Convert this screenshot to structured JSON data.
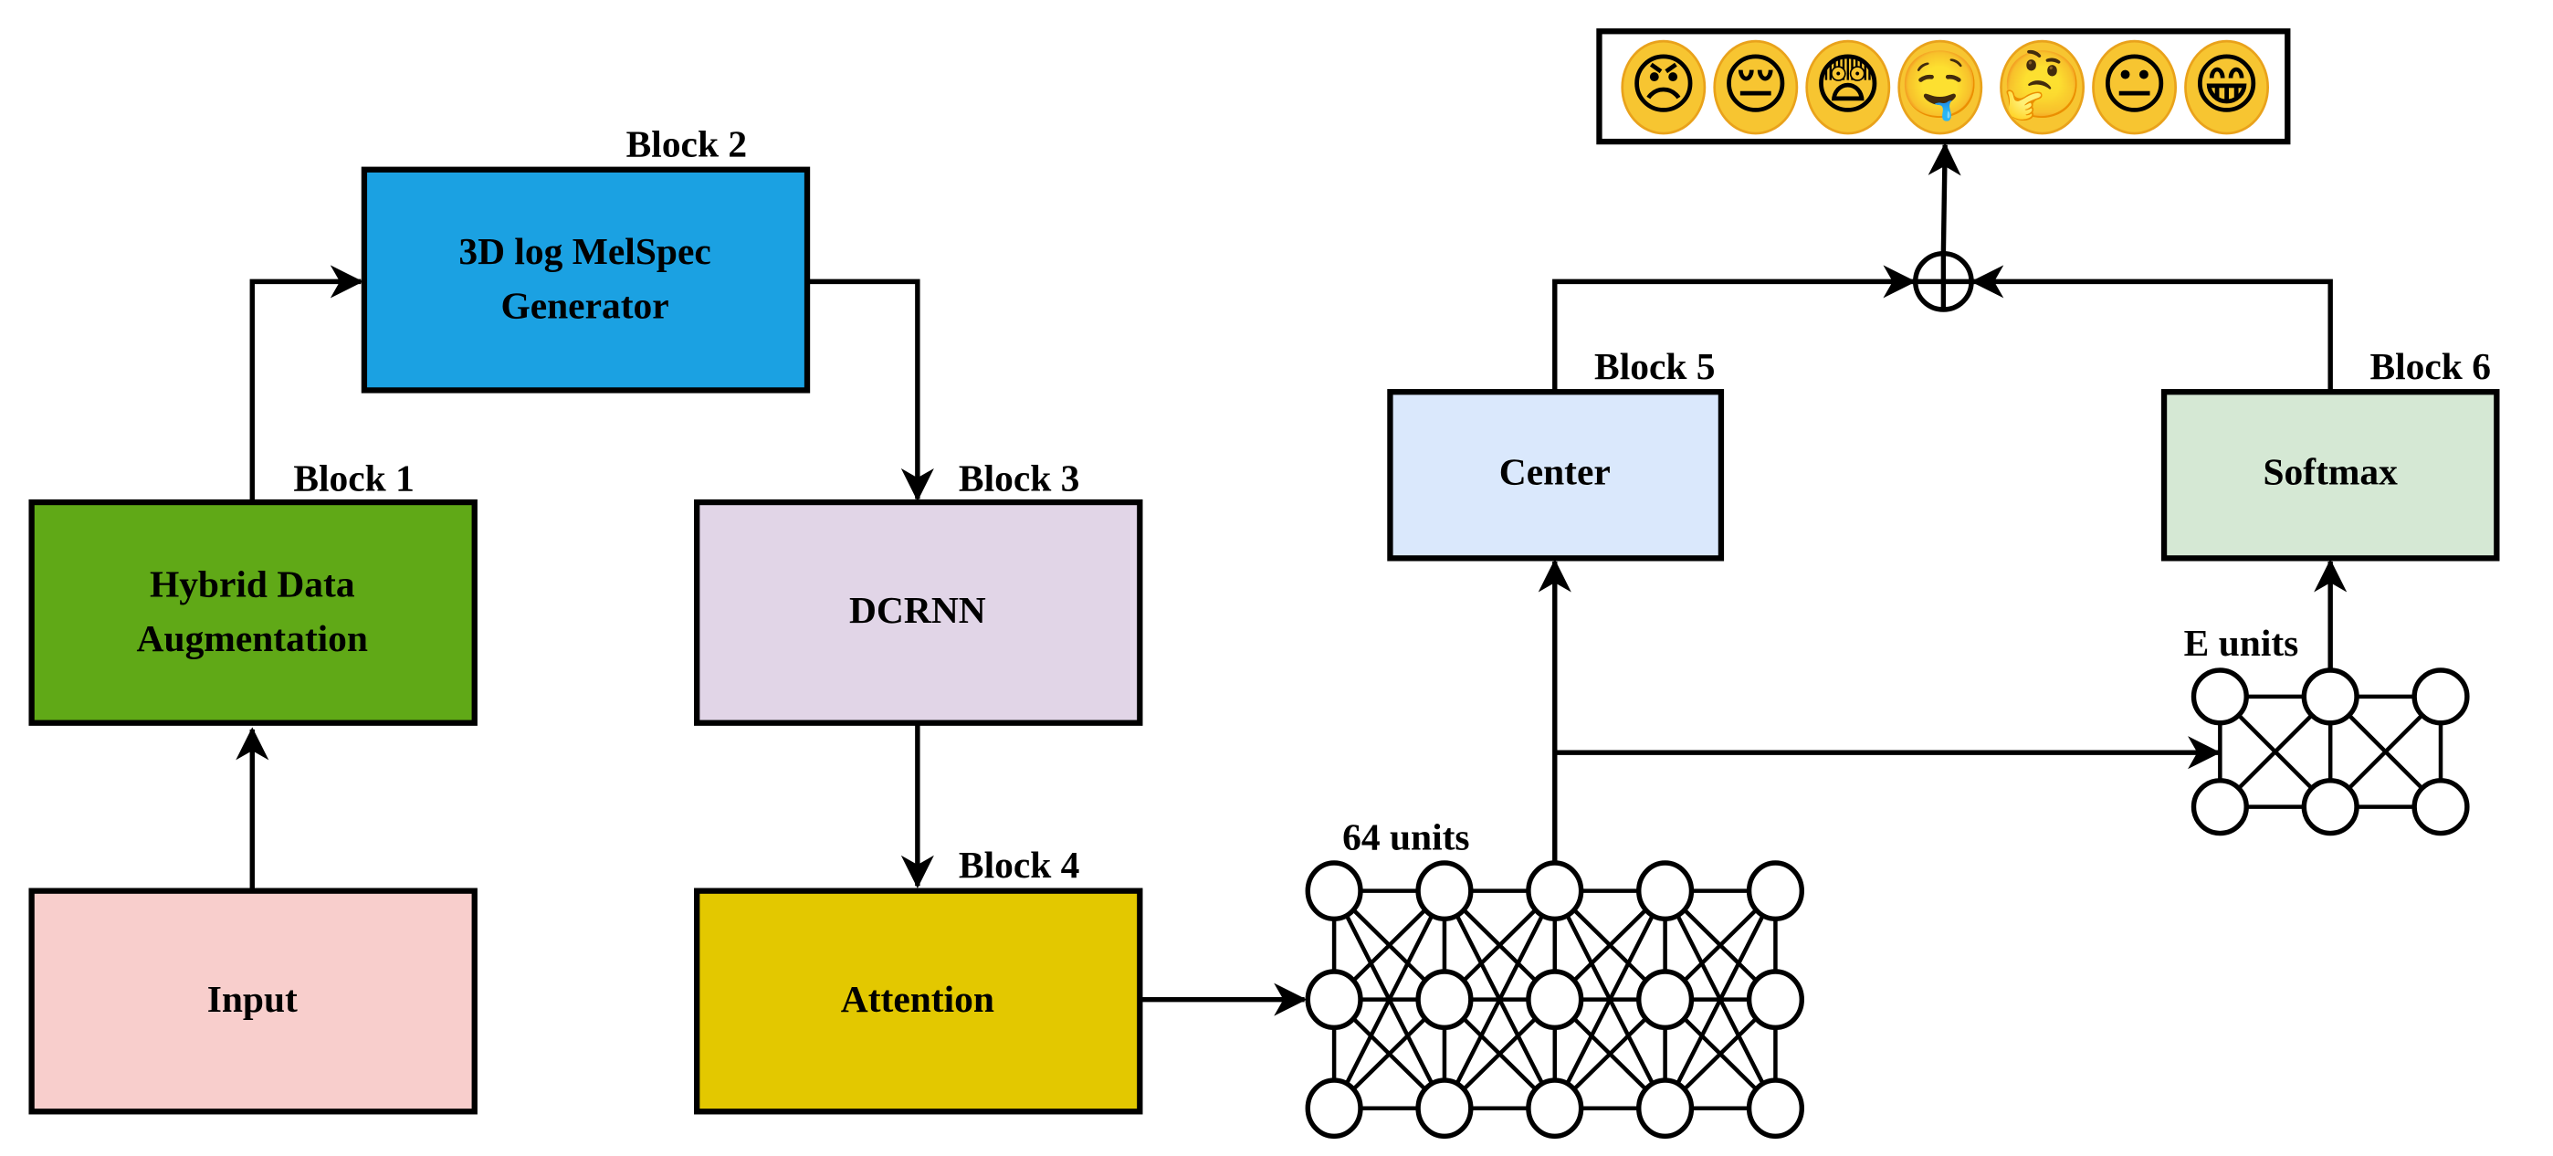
{
  "diagram": {
    "blocks": [
      {
        "id": "input",
        "tag": "",
        "lines": [
          "Input"
        ],
        "color": "#f8cecc"
      },
      {
        "id": "hybrid-data-augmentation",
        "tag": "Block 1",
        "lines": [
          "Hybrid Data",
          "Augmentation"
        ],
        "color": "#60a917"
      },
      {
        "id": "melspec-generator",
        "tag": "Block 2",
        "lines": [
          "3D log MelSpec",
          "Generator"
        ],
        "color": "#1ba1e2"
      },
      {
        "id": "dcrnn",
        "tag": "Block 3",
        "lines": [
          "DCRNN"
        ],
        "color": "#e1d5e7"
      },
      {
        "id": "attention",
        "tag": "Block 4",
        "lines": [
          "Attention"
        ],
        "color": "#e3c800"
      },
      {
        "id": "center",
        "tag": "Block 5",
        "lines": [
          "Center"
        ],
        "color": "#dae8fc"
      },
      {
        "id": "softmax",
        "tag": "Block 6",
        "lines": [
          "Softmax"
        ],
        "color": "#d5e8d4"
      }
    ],
    "dense_layer": {
      "label": "64 units",
      "columns": 5,
      "rows": 3
    },
    "embedding_layer": {
      "label": "E units",
      "columns": 3,
      "rows": 2
    },
    "combine_symbol": "sum-circle",
    "output": {
      "emotions": [
        "angry",
        "sad",
        "fearful",
        "disgust",
        "surprised",
        "neutral",
        "happy"
      ],
      "emojis": [
        "😠",
        "😔",
        "😨",
        "🤤",
        "🤔",
        "😐",
        "😁"
      ]
    }
  }
}
